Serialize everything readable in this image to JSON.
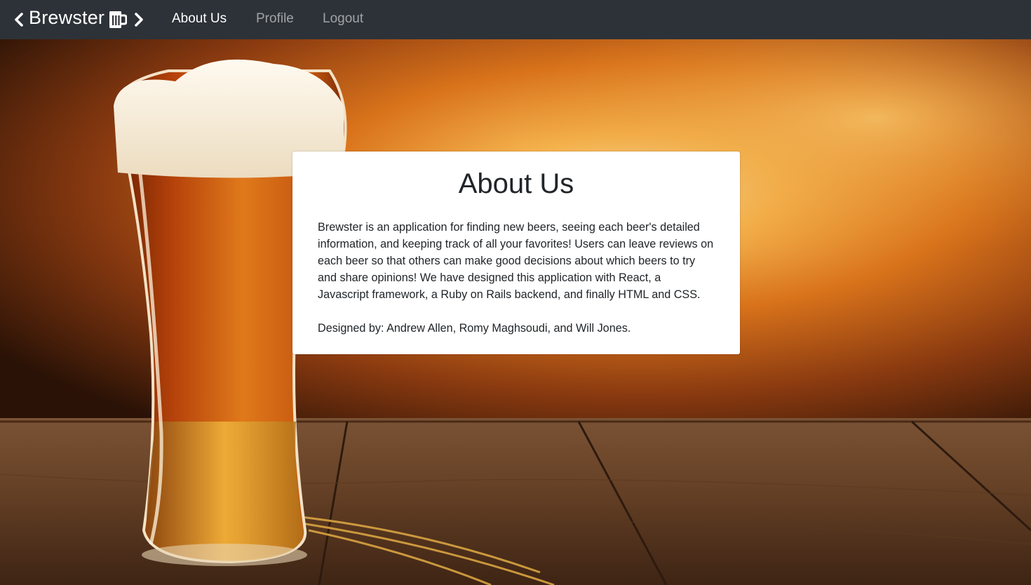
{
  "navbar": {
    "brand": "Brewster",
    "brand_icons": [
      "chevron-left-icon",
      "beer-mug-icon",
      "chevron-right-icon"
    ],
    "links": [
      {
        "label": "About Us",
        "active": true
      },
      {
        "label": "Profile",
        "active": false
      },
      {
        "label": "Logout",
        "active": false
      }
    ],
    "background": "#2d3238"
  },
  "about": {
    "title": "About Us",
    "description": "Brewster is an application for finding new beers, seeing each beer's detailed information, and keeping track of all your favorites! Users can leave reviews on each beer so that others can make good decisions about which beers to try and share opinions! We have designed this application with React, a Javascript framework, a Ruby on Rails backend, and finally HTML and CSS.",
    "credits": "Designed by: Andrew Allen, Romy Maghsoudi, and Will Jones."
  },
  "hero": {
    "image": "beer-glass-on-wooden-table-photo",
    "accent": "#e88a1c"
  }
}
